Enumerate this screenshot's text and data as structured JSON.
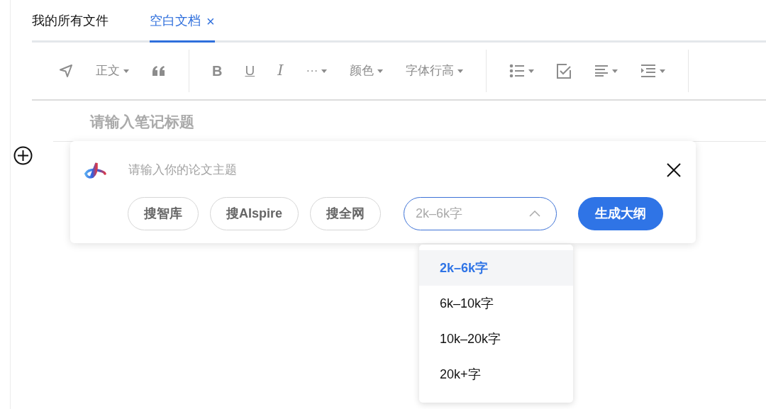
{
  "tabs": [
    {
      "label": "我的所有文件",
      "selected": false,
      "closable": false
    },
    {
      "label": "空白文档",
      "selected": true,
      "closable": true,
      "close": "×"
    }
  ],
  "toolbar": {
    "groups": [
      [
        {
          "kind": "send"
        },
        {
          "kind": "text",
          "label": "正文",
          "caret": true
        },
        {
          "kind": "quote"
        }
      ],
      [
        {
          "kind": "bold",
          "label": "B"
        },
        {
          "kind": "underline",
          "label": "U"
        },
        {
          "kind": "italic",
          "label": "I"
        },
        {
          "kind": "text",
          "label": "···",
          "caret": true
        },
        {
          "kind": "text",
          "label": "颜色",
          "caret": true
        },
        {
          "kind": "text",
          "label": "字体行高",
          "caret": true
        }
      ],
      [
        {
          "kind": "bullets",
          "caret": true
        },
        {
          "kind": "check"
        },
        {
          "kind": "align",
          "caret": true
        },
        {
          "kind": "indent",
          "caret": true
        }
      ]
    ]
  },
  "editor": {
    "title_placeholder": "请输入笔记标题"
  },
  "ai_panel": {
    "topic_placeholder": "请输入你的论文主题",
    "sources": [
      "搜智库",
      "搜AIspire",
      "搜全网"
    ],
    "length_select": {
      "value": "2k–6k字",
      "expanded": true
    },
    "generate_button": "生成大纲"
  },
  "length_options": [
    {
      "label": "2k–6k字",
      "selected": true
    },
    {
      "label": "6k–10k字",
      "selected": false
    },
    {
      "label": "10k–20k字",
      "selected": false
    },
    {
      "label": "20k+字",
      "selected": false
    }
  ]
}
